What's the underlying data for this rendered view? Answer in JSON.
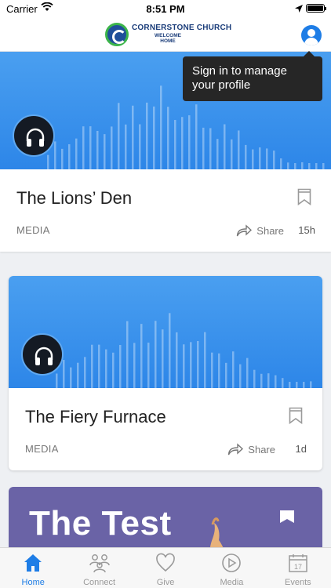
{
  "status_bar": {
    "carrier": "Carrier",
    "time": "8:51 PM"
  },
  "header": {
    "logo_name": "CORNERSTONE CHURCH",
    "logo_tagline": "WELCOME HOME"
  },
  "tooltip": {
    "text": "Sign in to manage your profile"
  },
  "feed": {
    "items": [
      {
        "title": "The Lions’ Den",
        "category": "MEDIA",
        "share_label": "Share",
        "age": "15h"
      },
      {
        "title": "The Fiery Furnace",
        "category": "MEDIA",
        "share_label": "Share",
        "age": "1d"
      },
      {
        "title": "The Test"
      }
    ]
  },
  "tabs": [
    {
      "label": "Home",
      "icon": "home-icon",
      "active": true
    },
    {
      "label": "Connect",
      "icon": "connect-icon"
    },
    {
      "label": "Give",
      "icon": "heart-icon"
    },
    {
      "label": "Media",
      "icon": "play-icon"
    },
    {
      "label": "Events",
      "icon": "calendar-icon",
      "calendar_day": "17"
    }
  ],
  "colors": {
    "accent": "#1e7de6",
    "banner": "#2d86e8",
    "tooltip": "#262626",
    "test_card": "#6a63a6"
  }
}
